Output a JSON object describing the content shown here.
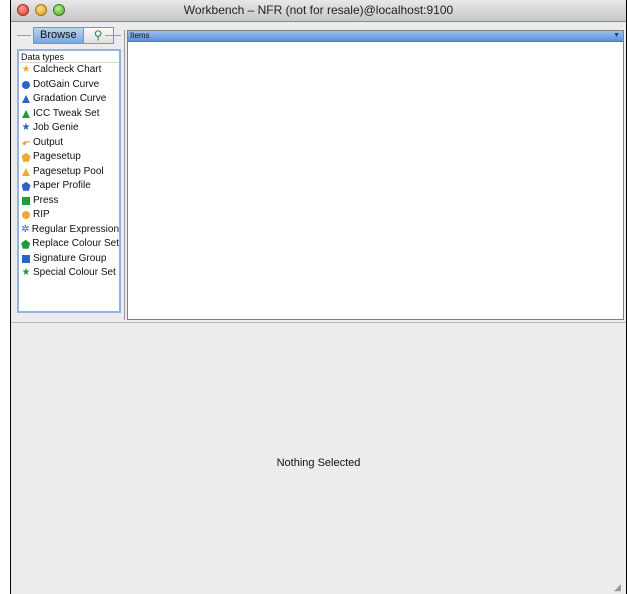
{
  "window": {
    "title": "Workbench – NFR (not for resale)@localhost:9100"
  },
  "browse": {
    "tab_label": "Browse",
    "search_glyph": "⚲"
  },
  "data_types": {
    "header": "Data types",
    "items": [
      {
        "label": "Calcheck Chart",
        "icon": "star-icon",
        "color": "#f0a73a"
      },
      {
        "label": "DotGain Curve",
        "icon": "circle-icon",
        "color": "#2f62c9"
      },
      {
        "label": "Gradation Curve",
        "icon": "triangle-icon",
        "color": "#2f62c9"
      },
      {
        "label": "ICC Tweak Set",
        "icon": "triangle-icon",
        "color": "#1f9b3a"
      },
      {
        "label": "Job Genie",
        "icon": "star-icon",
        "color": "#2f62c9"
      },
      {
        "label": "Output",
        "icon": "output-icon",
        "color": "#f0a73a"
      },
      {
        "label": "Pagesetup",
        "icon": "pentagon-icon",
        "color": "#f0a73a"
      },
      {
        "label": "Pagesetup Pool",
        "icon": "triangle-icon",
        "color": "#f0a73a"
      },
      {
        "label": "Paper Profile",
        "icon": "pentagon-icon",
        "color": "#2f62c9"
      },
      {
        "label": "Press",
        "icon": "square-icon",
        "color": "#1f9b3a"
      },
      {
        "label": "RIP",
        "icon": "circle-icon",
        "color": "#f0a73a"
      },
      {
        "label": "Regular Expression",
        "icon": "asterisk-icon",
        "color": "#2f62c9"
      },
      {
        "label": "Replace Colour Set",
        "icon": "pentagon-icon",
        "color": "#1f9b3a"
      },
      {
        "label": "Signature Group",
        "icon": "square-icon",
        "color": "#2f62c9"
      },
      {
        "label": "Special Colour Set",
        "icon": "star-icon",
        "color": "#1f9b3a"
      }
    ]
  },
  "items": {
    "header": "Items"
  },
  "detail": {
    "empty_message": "Nothing Selected"
  }
}
